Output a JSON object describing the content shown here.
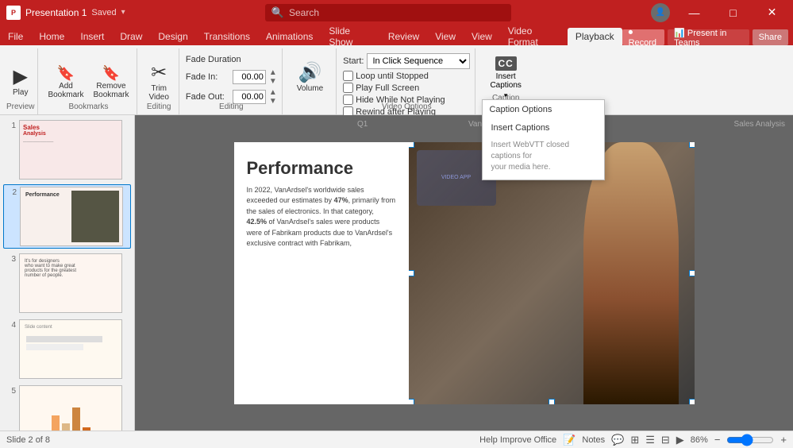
{
  "titlebar": {
    "logo": "P",
    "title": "Presentation 1",
    "save_status": "Saved",
    "search_placeholder": "Search",
    "minimize": "—",
    "restore": "□",
    "close": "✕"
  },
  "ribbon_tabs": [
    {
      "id": "file",
      "label": "File",
      "active": false
    },
    {
      "id": "home",
      "label": "Home",
      "active": false
    },
    {
      "id": "insert",
      "label": "Insert",
      "active": false
    },
    {
      "id": "draw",
      "label": "Draw",
      "active": false
    },
    {
      "id": "design",
      "label": "Design",
      "active": false
    },
    {
      "id": "transitions",
      "label": "Transitions",
      "active": false
    },
    {
      "id": "animations",
      "label": "Animations",
      "active": false
    },
    {
      "id": "slideshow",
      "label": "Slide Show",
      "active": false
    },
    {
      "id": "review",
      "label": "Review",
      "active": false
    },
    {
      "id": "view1",
      "label": "View",
      "active": false
    },
    {
      "id": "view2",
      "label": "View",
      "active": false
    },
    {
      "id": "videoformat",
      "label": "Video Format",
      "active": false
    },
    {
      "id": "playback",
      "label": "Playback",
      "active": true
    }
  ],
  "ribbon": {
    "preview_group_label": "Preview",
    "play_label": "Play",
    "bookmarks_group_label": "Bookmarks",
    "add_bookmark_label": "Add\nBookmark",
    "remove_bookmark_label": "Remove\nBookmark",
    "editing_group_label": "Editing",
    "trim_video_label": "Trim\nVideo",
    "fade_group_label": "Editing",
    "fade_duration_label": "Fade Duration",
    "fade_in_label": "Fade In:",
    "fade_in_value": "00.00",
    "fade_out_label": "Fade Out:",
    "fade_out_value": "00.00",
    "video_options_group_label": "Video Options",
    "volume_label": "Volume",
    "volume_icon": "🔊",
    "start_label": "Start:",
    "start_value": "In Click Sequence",
    "loop_label": "Loop until Stopped",
    "full_screen_label": "Play Full Screen",
    "hide_not_playing_label": "Hide While Not Playing",
    "rewind_after_label": "Rewind after Playing",
    "caption_group_label": "Caption Options",
    "insert_captions_label": "Insert\nCaptions",
    "cc_icon_text": "CC",
    "dropdown": {
      "header": "Caption Options",
      "insert_captions": "Insert Captions",
      "webvtt_label": "Insert WebVTT closed captions for",
      "webvtt_label2": "your media here."
    }
  },
  "slide_panel": {
    "slides": [
      {
        "num": 1,
        "label": "Sales Analysis slide 1"
      },
      {
        "num": 2,
        "label": "Performance slide - active"
      },
      {
        "num": 3,
        "label": "For designers slide"
      },
      {
        "num": 4,
        "label": "Unknown slide 4"
      },
      {
        "num": 5,
        "label": "Chart slide 5"
      }
    ]
  },
  "slide_canvas": {
    "q1_label": "Q1",
    "van_label": "VanArc...",
    "analysis_label": "Sales Analysis",
    "title": "Performance",
    "body": "In 2022, VanArdsel's worldwide sales exceeded our estimates by 47%, primarily from the sales of electronics. In that category, 42.5% of VanArdsel's sales were products were of Fabrikam products due to VanArdsel's exclusive contract with Fabrikam,"
  },
  "statusbar": {
    "slide_info": "Slide 2 of 8",
    "help_text": "Help Improve Office",
    "notes_label": "Notes",
    "zoom_level": "86%"
  },
  "right_buttons": {
    "record_label": "⏺ Record",
    "present_label": "📊 Present in Teams",
    "share_label": "Share"
  }
}
